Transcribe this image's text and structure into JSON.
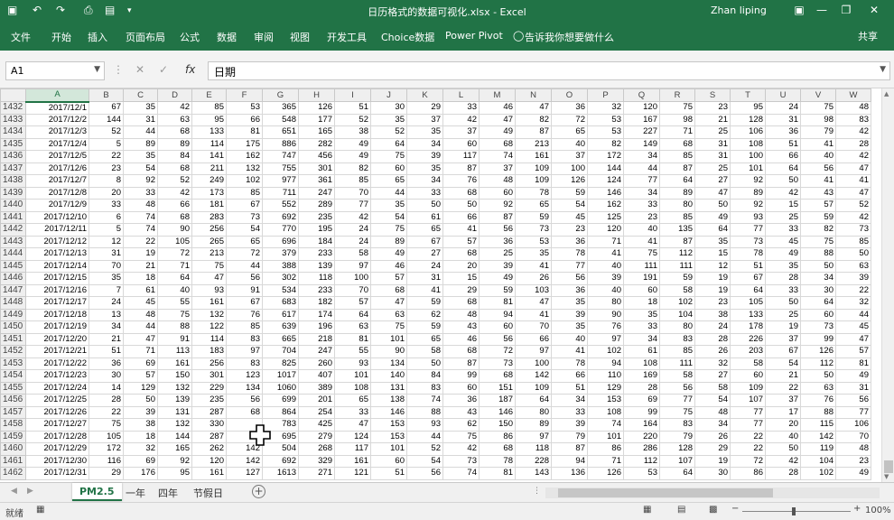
{
  "window": {
    "title": "日历格式的数据可视化.xlsx  -  Excel",
    "user": "Zhan liping"
  },
  "ribbon": {
    "tabs": [
      "文件",
      "开始",
      "插入",
      "页面布局",
      "公式",
      "数据",
      "审阅",
      "视图",
      "开发工具",
      "Choice数据",
      "Power Pivot",
      "告诉我你想要做什么"
    ],
    "share": "共享"
  },
  "formula_bar": {
    "name_box": "A1",
    "formula": "日期"
  },
  "sheet": {
    "selected_column": "A",
    "columns": [
      "A",
      "B",
      "C",
      "D",
      "E",
      "F",
      "G",
      "H",
      "I",
      "J",
      "K",
      "L",
      "M",
      "N",
      "O",
      "P",
      "Q",
      "R",
      "S",
      "T",
      "U",
      "V",
      "W"
    ],
    "rows": [
      {
        "n": "1432",
        "d": "2017/12/1",
        "v": [
          67,
          35,
          42,
          85,
          53,
          365,
          126,
          51,
          30,
          29,
          33,
          46,
          47,
          36,
          32,
          120,
          75,
          23,
          95,
          24,
          75,
          48
        ]
      },
      {
        "n": "1433",
        "d": "2017/12/2",
        "v": [
          144,
          31,
          63,
          95,
          66,
          548,
          177,
          52,
          35,
          37,
          42,
          47,
          82,
          72,
          53,
          167,
          98,
          21,
          128,
          31,
          98,
          83
        ]
      },
      {
        "n": "1434",
        "d": "2017/12/3",
        "v": [
          52,
          44,
          68,
          133,
          81,
          651,
          165,
          38,
          52,
          35,
          37,
          49,
          87,
          65,
          53,
          227,
          71,
          25,
          106,
          36,
          79,
          42
        ]
      },
      {
        "n": "1435",
        "d": "2017/12/4",
        "v": [
          5,
          89,
          89,
          114,
          175,
          886,
          282,
          49,
          64,
          34,
          60,
          68,
          213,
          40,
          82,
          149,
          68,
          31,
          108,
          51,
          41,
          28
        ]
      },
      {
        "n": "1436",
        "d": "2017/12/5",
        "v": [
          22,
          35,
          84,
          141,
          162,
          747,
          456,
          49,
          75,
          39,
          117,
          74,
          161,
          37,
          172,
          34,
          85,
          31,
          100,
          66,
          40,
          42
        ]
      },
      {
        "n": "1437",
        "d": "2017/12/6",
        "v": [
          23,
          54,
          68,
          211,
          132,
          755,
          301,
          82,
          60,
          35,
          87,
          37,
          109,
          100,
          144,
          44,
          87,
          25,
          101,
          64,
          56,
          47
        ]
      },
      {
        "n": "1438",
        "d": "2017/12/7",
        "v": [
          8,
          92,
          52,
          249,
          102,
          977,
          361,
          85,
          65,
          34,
          76,
          48,
          109,
          126,
          124,
          77,
          64,
          27,
          92,
          50,
          41,
          41
        ]
      },
      {
        "n": "1439",
        "d": "2017/12/8",
        "v": [
          20,
          33,
          42,
          173,
          85,
          711,
          247,
          70,
          44,
          33,
          68,
          60,
          78,
          59,
          146,
          34,
          89,
          47,
          89,
          42,
          43,
          47
        ]
      },
      {
        "n": "1440",
        "d": "2017/12/9",
        "v": [
          33,
          48,
          66,
          181,
          67,
          552,
          289,
          77,
          35,
          50,
          50,
          92,
          65,
          54,
          162,
          33,
          80,
          50,
          92,
          15,
          57,
          52
        ]
      },
      {
        "n": "1441",
        "d": "2017/12/10",
        "v": [
          6,
          74,
          68,
          283,
          73,
          692,
          235,
          42,
          54,
          61,
          66,
          87,
          59,
          45,
          125,
          23,
          85,
          49,
          93,
          25,
          59,
          42
        ]
      },
      {
        "n": "1442",
        "d": "2017/12/11",
        "v": [
          5,
          74,
          90,
          256,
          54,
          770,
          195,
          24,
          75,
          65,
          41,
          56,
          73,
          23,
          120,
          40,
          135,
          64,
          77,
          33,
          82,
          73
        ]
      },
      {
        "n": "1443",
        "d": "2017/12/12",
        "v": [
          12,
          22,
          105,
          265,
          65,
          696,
          184,
          24,
          89,
          67,
          57,
          36,
          53,
          36,
          71,
          41,
          87,
          35,
          73,
          45,
          75,
          85
        ]
      },
      {
        "n": "1444",
        "d": "2017/12/13",
        "v": [
          31,
          19,
          72,
          213,
          72,
          379,
          233,
          58,
          49,
          27,
          68,
          25,
          35,
          78,
          41,
          75,
          112,
          15,
          78,
          49,
          88,
          50
        ]
      },
      {
        "n": "1445",
        "d": "2017/12/14",
        "v": [
          70,
          21,
          71,
          75,
          44,
          388,
          139,
          97,
          46,
          24,
          20,
          39,
          41,
          77,
          40,
          111,
          111,
          12,
          51,
          35,
          50,
          63
        ]
      },
      {
        "n": "1446",
        "d": "2017/12/15",
        "v": [
          35,
          18,
          64,
          47,
          56,
          302,
          118,
          100,
          57,
          31,
          15,
          49,
          26,
          56,
          39,
          191,
          59,
          19,
          67,
          28,
          34,
          39
        ]
      },
      {
        "n": "1447",
        "d": "2017/12/16",
        "v": [
          7,
          61,
          40,
          93,
          91,
          534,
          233,
          70,
          68,
          41,
          29,
          59,
          103,
          36,
          40,
          60,
          58,
          19,
          64,
          33,
          30,
          22
        ]
      },
      {
        "n": "1448",
        "d": "2017/12/17",
        "v": [
          24,
          45,
          55,
          161,
          67,
          683,
          182,
          57,
          47,
          59,
          68,
          81,
          47,
          35,
          80,
          18,
          102,
          23,
          105,
          50,
          64,
          32
        ]
      },
      {
        "n": "1449",
        "d": "2017/12/18",
        "v": [
          13,
          48,
          75,
          132,
          76,
          617,
          174,
          64,
          63,
          62,
          48,
          94,
          41,
          39,
          90,
          35,
          104,
          38,
          133,
          25,
          60,
          44
        ]
      },
      {
        "n": "1450",
        "d": "2017/12/19",
        "v": [
          34,
          44,
          88,
          122,
          85,
          639,
          196,
          63,
          75,
          59,
          43,
          60,
          70,
          35,
          76,
          33,
          80,
          24,
          178,
          19,
          73,
          45
        ]
      },
      {
        "n": "1451",
        "d": "2017/12/20",
        "v": [
          21,
          47,
          91,
          114,
          83,
          665,
          218,
          81,
          101,
          65,
          46,
          56,
          66,
          40,
          97,
          34,
          83,
          28,
          226,
          37,
          99,
          47
        ]
      },
      {
        "n": "1452",
        "d": "2017/12/21",
        "v": [
          51,
          71,
          113,
          183,
          97,
          704,
          247,
          55,
          90,
          58,
          68,
          72,
          97,
          41,
          102,
          61,
          85,
          26,
          203,
          67,
          126,
          57
        ]
      },
      {
        "n": "1453",
        "d": "2017/12/22",
        "v": [
          36,
          69,
          161,
          256,
          83,
          825,
          260,
          93,
          134,
          50,
          87,
          73,
          100,
          78,
          94,
          108,
          111,
          32,
          58,
          54,
          112,
          81
        ]
      },
      {
        "n": "1454",
        "d": "2017/12/23",
        "v": [
          30,
          57,
          150,
          301,
          123,
          1017,
          407,
          101,
          140,
          84,
          99,
          68,
          142,
          66,
          110,
          169,
          58,
          27,
          60,
          21,
          50,
          49
        ]
      },
      {
        "n": "1455",
        "d": "2017/12/24",
        "v": [
          14,
          129,
          132,
          229,
          134,
          1060,
          389,
          108,
          131,
          83,
          60,
          151,
          109,
          51,
          129,
          28,
          56,
          58,
          109,
          22,
          63,
          31
        ]
      },
      {
        "n": "1456",
        "d": "2017/12/25",
        "v": [
          28,
          50,
          139,
          235,
          56,
          699,
          201,
          65,
          138,
          74,
          36,
          187,
          64,
          34,
          153,
          69,
          77,
          54,
          107,
          37,
          76,
          56
        ]
      },
      {
        "n": "1457",
        "d": "2017/12/26",
        "v": [
          22,
          39,
          131,
          287,
          68,
          864,
          254,
          33,
          146,
          88,
          43,
          146,
          80,
          33,
          108,
          99,
          75,
          48,
          77,
          17,
          88,
          77
        ]
      },
      {
        "n": "1458",
        "d": "2017/12/27",
        "v": [
          75,
          38,
          132,
          330,
          "",
          783,
          425,
          47,
          153,
          93,
          62,
          150,
          89,
          39,
          74,
          164,
          83,
          34,
          77,
          20,
          115,
          106
        ]
      },
      {
        "n": "1459",
        "d": "2017/12/28",
        "v": [
          105,
          18,
          144,
          287,
          "",
          695,
          279,
          124,
          153,
          44,
          75,
          86,
          97,
          79,
          101,
          220,
          79,
          26,
          22,
          40,
          142,
          70
        ]
      },
      {
        "n": "1460",
        "d": "2017/12/29",
        "v": [
          172,
          32,
          165,
          262,
          142,
          504,
          268,
          117,
          101,
          52,
          42,
          68,
          118,
          87,
          86,
          286,
          128,
          29,
          22,
          50,
          119,
          48
        ]
      },
      {
        "n": "1461",
        "d": "2017/12/30",
        "v": [
          116,
          69,
          92,
          120,
          142,
          692,
          329,
          161,
          60,
          54,
          73,
          78,
          228,
          94,
          71,
          112,
          107,
          19,
          72,
          42,
          104,
          23
        ]
      },
      {
        "n": "1462",
        "d": "2017/12/31",
        "v": [
          29,
          176,
          95,
          161,
          127,
          1613,
          271,
          121,
          51,
          56,
          74,
          81,
          143,
          136,
          126,
          53,
          64,
          30,
          86,
          28,
          102,
          49
        ]
      }
    ]
  },
  "sheet_tabs": [
    "PM2.5",
    "一年",
    "四年",
    "节假日"
  ],
  "active_sheet": "PM2.5",
  "status": {
    "ready": "就绪",
    "zoom": "100%"
  }
}
